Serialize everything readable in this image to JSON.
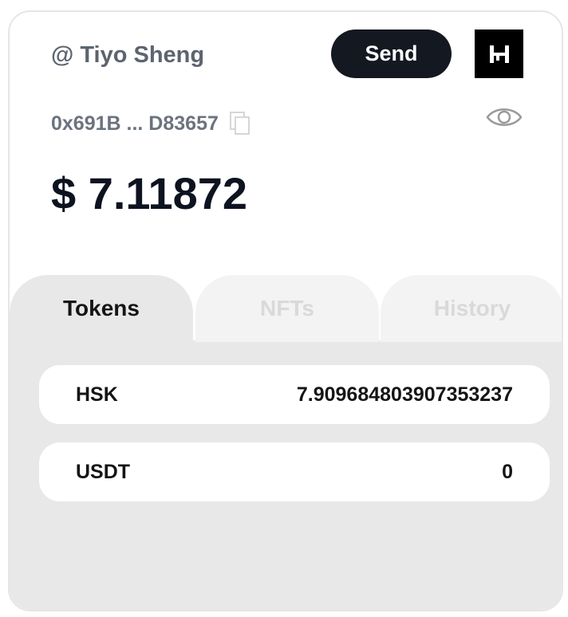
{
  "header": {
    "username": "@ Tiyo Sheng",
    "send_label": "Send",
    "logo_icon": "hashkey-logo-icon"
  },
  "wallet": {
    "address": "0x691B ... D83657",
    "copy_icon": "copy-icon",
    "visibility_icon": "eye-icon",
    "balance": "$ 7.11872"
  },
  "tabs": [
    {
      "label": "Tokens",
      "active": true
    },
    {
      "label": "NFTs",
      "active": false
    },
    {
      "label": "History",
      "active": false
    }
  ],
  "tokens": [
    {
      "symbol": "HSK",
      "amount": "7.909684803907353237"
    },
    {
      "symbol": "USDT",
      "amount": "0"
    }
  ],
  "colors": {
    "accent": "#141821",
    "panel_bg": "#e8e8e8",
    "inactive_tab": "#f3f3f3",
    "muted_text": "#5c6470"
  }
}
